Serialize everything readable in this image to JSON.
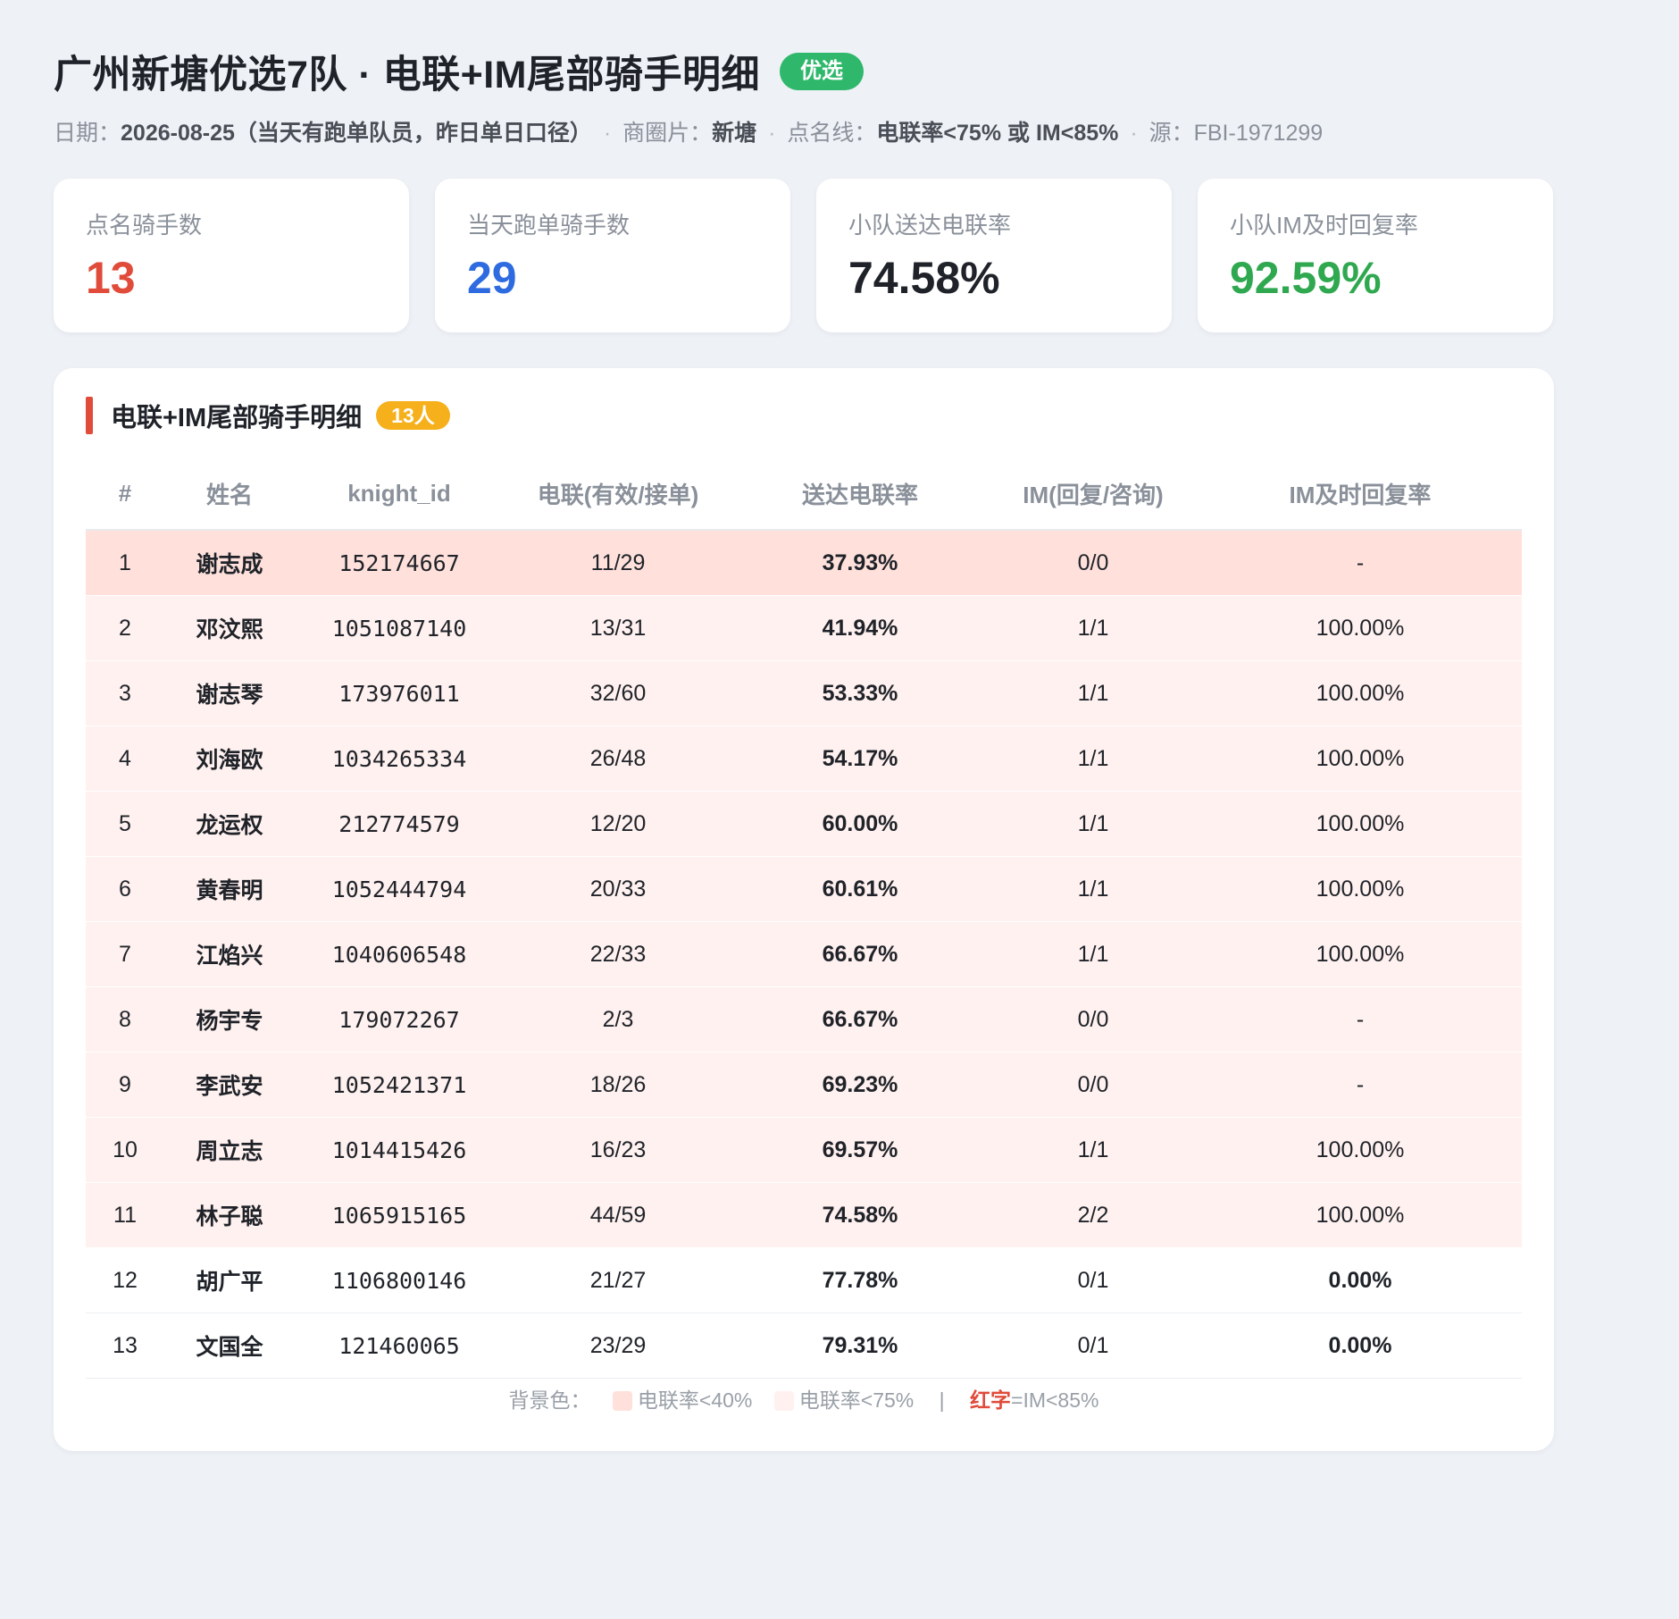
{
  "header": {
    "title": "广州新塘优选7队 · 电联+IM尾部骑手明细",
    "badge": "优选",
    "date_label": "日期：",
    "date_value": "2026-08-25（当天有跑单队员，昨日单日口径）",
    "area_label": "商圈片：",
    "area_value": "新塘",
    "threshold_label": "点名线：",
    "threshold_value": "电联率<75% 或 IM<85%",
    "source_label": "源：",
    "source_value": "FBI-1971299",
    "separator": "·"
  },
  "kpis": [
    {
      "label": "点名骑手数",
      "value": "13",
      "color": "#e04b3a"
    },
    {
      "label": "当天跑单骑手数",
      "value": "29",
      "color": "#2f6be0"
    },
    {
      "label": "小队送达电联率",
      "value": "74.58%",
      "color": "#1f2329"
    },
    {
      "label": "小队IM及时回复率",
      "value": "92.59%",
      "color": "#2fa84f"
    }
  ],
  "panel": {
    "title": "电联+IM尾部骑手明细",
    "count_badge": "13人"
  },
  "table": {
    "columns": [
      "#",
      "姓名",
      "knight_id",
      "电联(有效/接单)",
      "送达电联率",
      "IM(回复/咨询)",
      "IM及时回复率"
    ],
    "rows": [
      {
        "idx": "1",
        "name": "谢志成",
        "knight_id": "152174667",
        "calls": "11/29",
        "call_rate": "37.93%",
        "im": "0/0",
        "im_rate": "-",
        "severity": 1,
        "im_red": false
      },
      {
        "idx": "2",
        "name": "邓汶熙",
        "knight_id": "1051087140",
        "calls": "13/31",
        "call_rate": "41.94%",
        "im": "1/1",
        "im_rate": "100.00%",
        "severity": 2,
        "im_red": false
      },
      {
        "idx": "3",
        "name": "谢志琴",
        "knight_id": "173976011",
        "calls": "32/60",
        "call_rate": "53.33%",
        "im": "1/1",
        "im_rate": "100.00%",
        "severity": 2,
        "im_red": false
      },
      {
        "idx": "4",
        "name": "刘海欧",
        "knight_id": "1034265334",
        "calls": "26/48",
        "call_rate": "54.17%",
        "im": "1/1",
        "im_rate": "100.00%",
        "severity": 2,
        "im_red": false
      },
      {
        "idx": "5",
        "name": "龙运权",
        "knight_id": "212774579",
        "calls": "12/20",
        "call_rate": "60.00%",
        "im": "1/1",
        "im_rate": "100.00%",
        "severity": 2,
        "im_red": false
      },
      {
        "idx": "6",
        "name": "黄春明",
        "knight_id": "1052444794",
        "calls": "20/33",
        "call_rate": "60.61%",
        "im": "1/1",
        "im_rate": "100.00%",
        "severity": 2,
        "im_red": false
      },
      {
        "idx": "7",
        "name": "江焰兴",
        "knight_id": "1040606548",
        "calls": "22/33",
        "call_rate": "66.67%",
        "im": "1/1",
        "im_rate": "100.00%",
        "severity": 2,
        "im_red": false
      },
      {
        "idx": "8",
        "name": "杨宇专",
        "knight_id": "179072267",
        "calls": "2/3",
        "call_rate": "66.67%",
        "im": "0/0",
        "im_rate": "-",
        "severity": 2,
        "im_red": false
      },
      {
        "idx": "9",
        "name": "李武安",
        "knight_id": "1052421371",
        "calls": "18/26",
        "call_rate": "69.23%",
        "im": "0/0",
        "im_rate": "-",
        "severity": 2,
        "im_red": false
      },
      {
        "idx": "10",
        "name": "周立志",
        "knight_id": "1014415426",
        "calls": "16/23",
        "call_rate": "69.57%",
        "im": "1/1",
        "im_rate": "100.00%",
        "severity": 2,
        "im_red": false
      },
      {
        "idx": "11",
        "name": "林子聪",
        "knight_id": "1065915165",
        "calls": "44/59",
        "call_rate": "74.58%",
        "im": "2/2",
        "im_rate": "100.00%",
        "severity": 2,
        "im_red": false
      },
      {
        "idx": "12",
        "name": "胡广平",
        "knight_id": "1106800146",
        "calls": "21/27",
        "call_rate": "77.78%",
        "im": "0/1",
        "im_rate": "0.00%",
        "severity": 3,
        "im_red": true
      },
      {
        "idx": "13",
        "name": "文国全",
        "knight_id": "121460065",
        "calls": "23/29",
        "call_rate": "79.31%",
        "im": "0/1",
        "im_rate": "0.00%",
        "severity": 3,
        "im_red": true
      }
    ]
  },
  "legend": {
    "prefix": "背景色：",
    "item1_label": "电联率<40%",
    "item1_color": "#ffe0db",
    "item2_label": "电联率<75%",
    "item2_color": "#fff1ef",
    "separator": "|",
    "red_word": "红字",
    "red_rule": "=IM<85%"
  }
}
